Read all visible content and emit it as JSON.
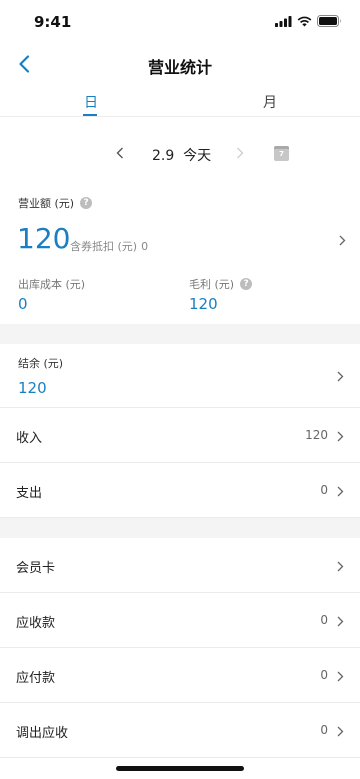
{
  "status_bar": {
    "time": "9:41"
  },
  "header": {
    "title": "营业统计"
  },
  "tabs": [
    {
      "label": "日"
    },
    {
      "label": "月"
    }
  ],
  "date_nav": {
    "date": "2.9",
    "today": "今天",
    "calendar_day": "7"
  },
  "revenue": {
    "label": "营业额 (元)",
    "value": "120",
    "coupon_label": "含券抵扣 (元)",
    "coupon_value": "0",
    "cost_label": "出库成本 (元)",
    "cost_value": "0",
    "profit_label": "毛利 (元)",
    "profit_value": "120"
  },
  "balance": {
    "label": "结余 (元)",
    "value": "120"
  },
  "rows": [
    {
      "label": "收入",
      "value": "120"
    },
    {
      "label": "支出",
      "value": "0"
    },
    {
      "label": "会员卡",
      "value": ""
    },
    {
      "label": "应收款",
      "value": "0"
    },
    {
      "label": "应付款",
      "value": "0"
    },
    {
      "label": "调出应收",
      "value": "0"
    }
  ],
  "colors": {
    "accent": "#1a7fc1",
    "divider": "#ececec",
    "section_gap": "#f4f4f4"
  }
}
